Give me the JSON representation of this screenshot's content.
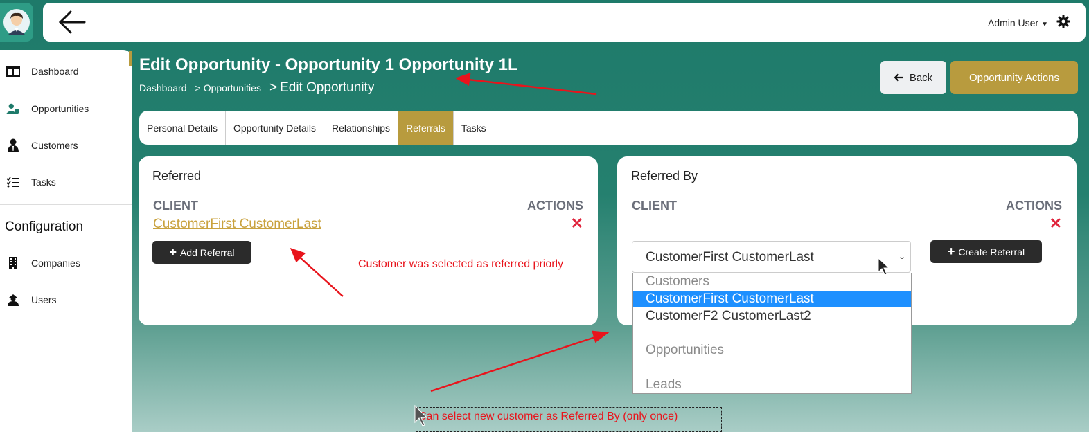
{
  "topbar": {
    "user_name": "Admin User"
  },
  "sidebar": {
    "items": [
      {
        "label": "Dashboard",
        "icon": "dashboard-icon"
      },
      {
        "label": "Opportunities",
        "icon": "opportunities-icon"
      },
      {
        "label": "Customers",
        "icon": "customer-icon"
      },
      {
        "label": "Tasks",
        "icon": "tasks-icon"
      }
    ],
    "config_heading": "Configuration",
    "config_items": [
      {
        "label": "Companies",
        "icon": "building-icon"
      },
      {
        "label": "Users",
        "icon": "users-icon"
      }
    ]
  },
  "page": {
    "title": "Edit Opportunity - Opportunity 1 Opportunity 1L",
    "breadcrumb": [
      "Dashboard",
      "Opportunities",
      "Edit Opportunity"
    ]
  },
  "header_buttons": {
    "back": "Back",
    "actions": "Opportunity Actions"
  },
  "tabs": [
    "Personal Details",
    "Opportunity Details",
    "Relationships",
    "Referrals",
    "Tasks"
  ],
  "active_tab": "Referrals",
  "referred": {
    "title": "Referred",
    "col_client": "CLIENT",
    "col_actions": "ACTIONS",
    "client_name": "CustomerFirst CustomerLast",
    "add_button": "Add Referral"
  },
  "referred_by": {
    "title": "Referred By",
    "col_client": "CLIENT",
    "col_actions": "ACTIONS",
    "select_value": "CustomerFirst CustomerLast",
    "create_button": "Create Referral",
    "dropdown": {
      "group_customers": "Customers",
      "option_1": "CustomerFirst CustomerLast",
      "option_2": "CustomerF2 CustomerLast2",
      "group_opportunities": "Opportunities",
      "group_leads": "Leads"
    }
  },
  "annotations": {
    "note_referred": "Customer was selected as referred  priorly",
    "note_referred_by": "Can select new customer as Referred By (only once)"
  },
  "colors": {
    "teal": "#1e7a6a",
    "gold": "#b89b3e",
    "annotation_red": "#e8141c",
    "delete_red": "#e0243c",
    "select_blue": "#1e90ff"
  }
}
